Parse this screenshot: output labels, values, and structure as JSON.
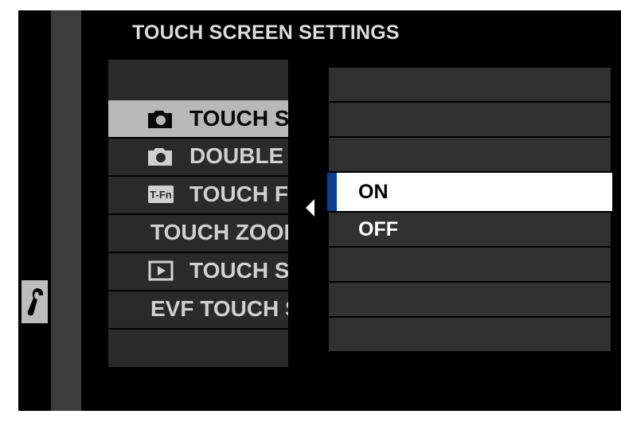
{
  "header": {
    "title": "TOUCH SCREEN SETTINGS"
  },
  "side_tab": {
    "icon": "wrench-icon"
  },
  "menu": {
    "items": [
      {
        "label": "",
        "icon": ""
      },
      {
        "label": "TOUCH SCREEN SETTING",
        "icon": "camera-icon",
        "selected": true
      },
      {
        "label": "DOUBLE TAP SETTING",
        "icon": "camera-icon"
      },
      {
        "label": "TOUCH FUNCTION",
        "icon": "t-fn-icon"
      },
      {
        "label": "TOUCH ZOOM",
        "icon": ""
      },
      {
        "label": "TOUCH SCREEN SETTING",
        "icon": "playback-icon"
      },
      {
        "label": "EVF TOUCH SCREEN AREA SETTINGS",
        "icon": ""
      },
      {
        "label": "",
        "icon": ""
      }
    ]
  },
  "submenu": {
    "options": [
      {
        "label": ""
      },
      {
        "label": ""
      },
      {
        "label": ""
      },
      {
        "label": "ON",
        "selected": true
      },
      {
        "label": "OFF"
      },
      {
        "label": ""
      },
      {
        "label": ""
      },
      {
        "label": ""
      }
    ]
  },
  "colors": {
    "accent": "#0b3d91",
    "selected_menu_bg": "#b8b8b8",
    "selected_option_bg": "#ffffff"
  }
}
